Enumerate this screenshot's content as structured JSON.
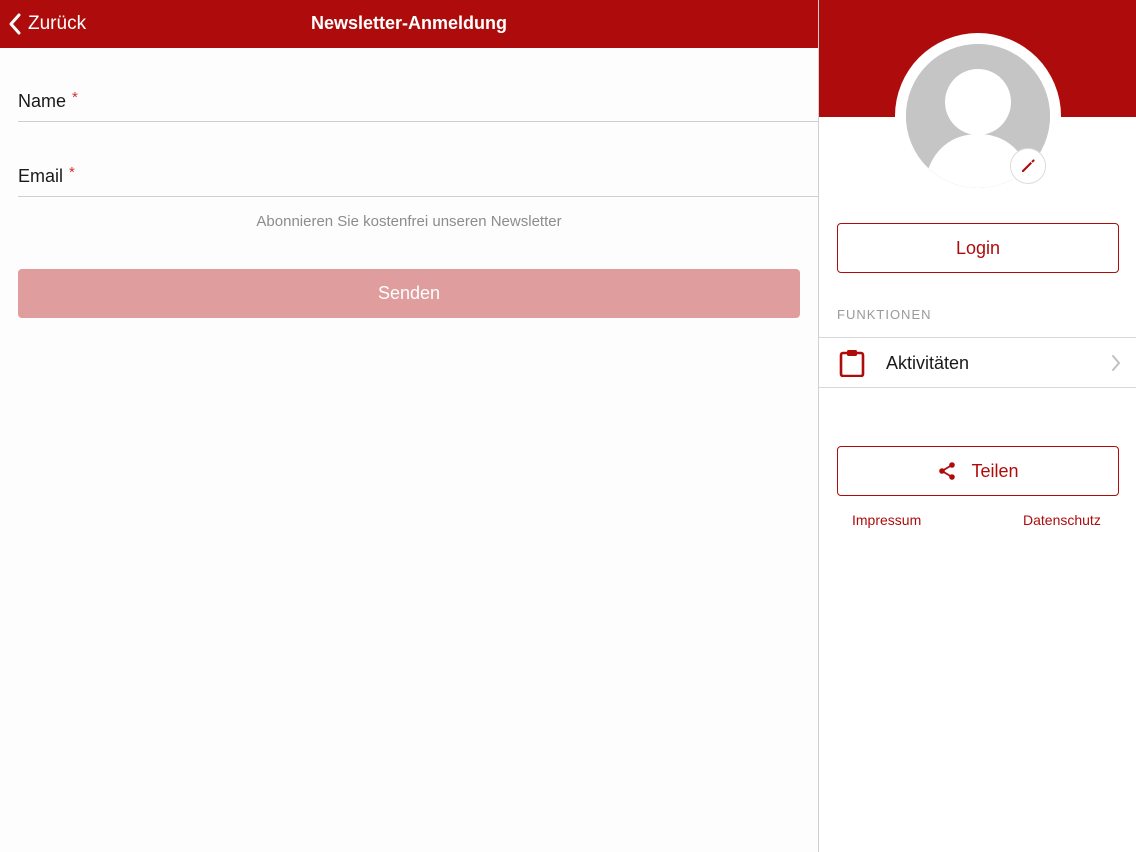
{
  "navbar": {
    "back_label": "Zurück",
    "title": "Newsletter-Anmeldung"
  },
  "form": {
    "name_label": "Name",
    "email_label": "Email",
    "required_marker": "*",
    "hint": "Abonnieren Sie kostenfrei unseren Newsletter",
    "send_label": "Senden"
  },
  "sidebar": {
    "login_label": "Login",
    "section_label": "FUNKTIONEN",
    "items": [
      {
        "label": "Aktivitäten",
        "icon": "clipboard-icon"
      }
    ],
    "share_label": "Teilen",
    "links": {
      "impressum": "Impressum",
      "datenschutz": "Datenschutz"
    }
  },
  "colors": {
    "brand": "#ae0c0c",
    "send_button_disabled": "#e09d9d",
    "avatar_placeholder": "#c5c5c5"
  },
  "icons": {
    "back": "chevron-left-icon",
    "edit": "pencil-icon",
    "share": "share-icon",
    "chevron": "chevron-right-icon"
  }
}
